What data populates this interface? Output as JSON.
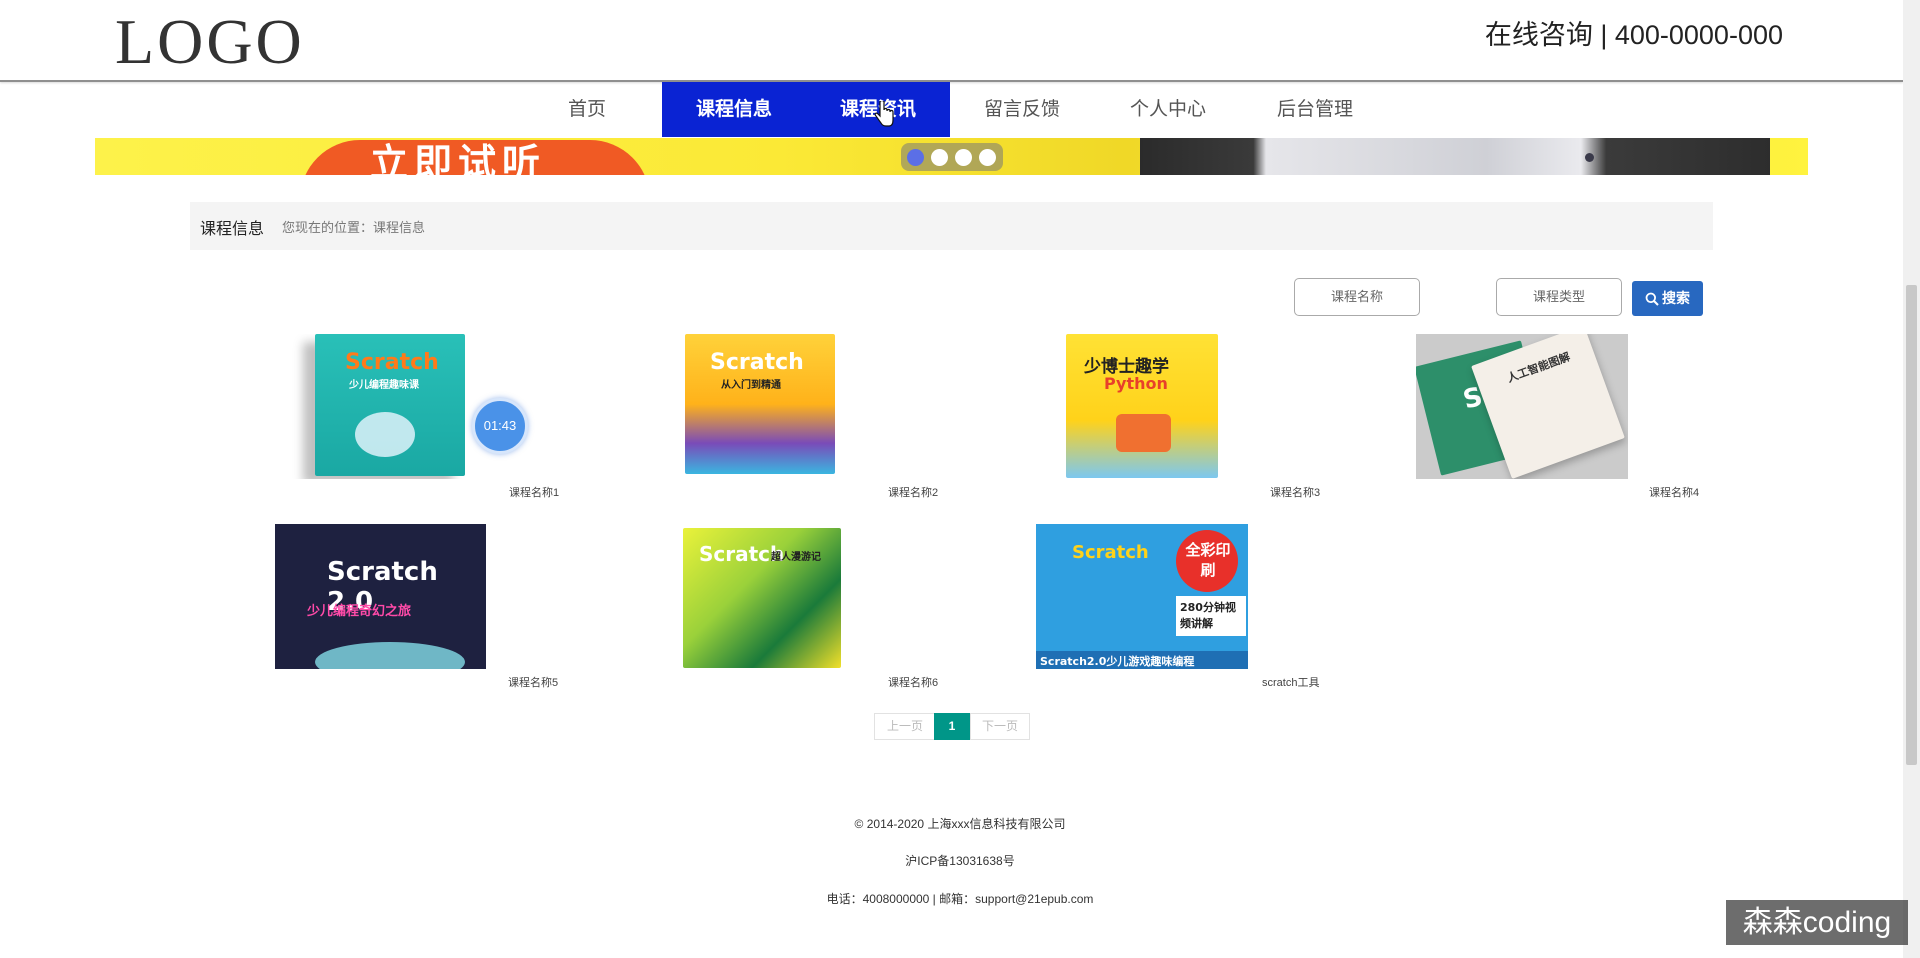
{
  "header": {
    "logo": "LOGO",
    "hotline": "在线咨询 | 400-0000-000"
  },
  "nav": {
    "items": [
      {
        "label": "首页"
      },
      {
        "label": "课程信息"
      },
      {
        "label": "课程资讯"
      },
      {
        "label": "留言反馈"
      },
      {
        "label": "个人中心"
      },
      {
        "label": "后台管理"
      }
    ],
    "active_color": "#0a23d3"
  },
  "banner": {
    "text": "立即试听",
    "slides_total": 4,
    "active_slide": 1
  },
  "breadcrumb": {
    "title": "课程信息",
    "path": "您现在的位置：课程信息"
  },
  "search": {
    "name_placeholder": "课程名称",
    "type_placeholder": "课程类型",
    "button_label": "搜索"
  },
  "timer": "01:43",
  "courses": [
    {
      "name": "课程名称1",
      "cover_title": "Scratch",
      "cover_sub": "少儿编程趣味课"
    },
    {
      "name": "课程名称2",
      "cover_title": "Scratch",
      "cover_sub": "从入门到精通"
    },
    {
      "name": "课程名称3",
      "cover_title": "少博士趣学",
      "cover_sub": "Python"
    },
    {
      "name": "课程名称4",
      "cover_title": "Sc",
      "cover_sub": "人工智能图解"
    },
    {
      "name": "课程名称5",
      "cover_title": "Scratch 2.0",
      "cover_sub": "少儿编程奇幻之旅"
    },
    {
      "name": "课程名称6",
      "cover_title": "Scratch",
      "cover_sub": "超人漫游记"
    },
    {
      "name": "scratch工具",
      "cover_title": "Scratch",
      "cover_sub": "Scratch2.0少儿游戏趣味编程",
      "badge": "全彩印刷",
      "badge2": "280分钟视频讲解"
    }
  ],
  "pagination": {
    "prev": "上一页",
    "current": "1",
    "next": "下一页"
  },
  "footer": {
    "copyright": "© 2014-2020 上海xxx信息科技有限公司",
    "icp": "沪ICP备13031638号",
    "contact": "电话：4008000000 | 邮箱：support@21epub.com"
  },
  "watermark": "森森coding"
}
